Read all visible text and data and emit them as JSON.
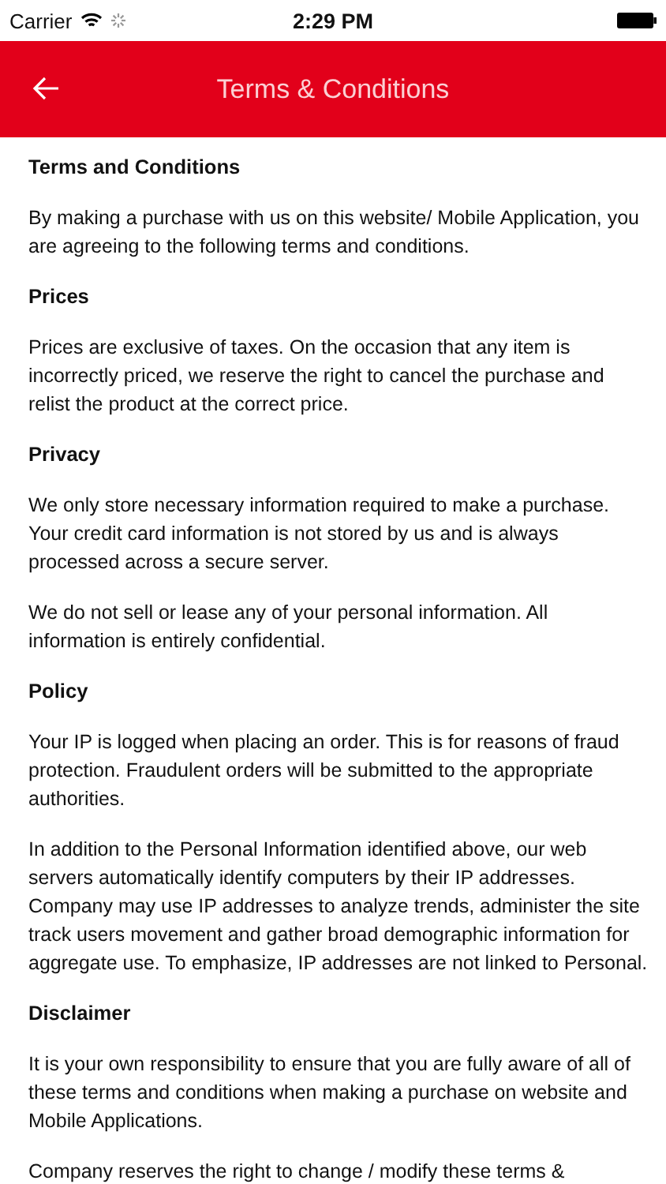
{
  "status_bar": {
    "carrier": "Carrier",
    "time": "2:29 PM"
  },
  "nav_bar": {
    "title": "Terms & Conditions"
  },
  "blocks": [
    {
      "kind": "heading",
      "lines": [
        "Terms and Conditions"
      ]
    },
    {
      "kind": "paragraph",
      "lines": [
        "By making a purchase with us on this website/ Mobile Application, you",
        "are agreeing to the following terms and conditions."
      ]
    },
    {
      "kind": "heading",
      "lines": [
        "Prices"
      ]
    },
    {
      "kind": "paragraph",
      "lines": [
        "Prices are exclusive of taxes. On the occasion that any item is",
        "incorrectly priced, we reserve the right to cancel the purchase and",
        "relist the product at the correct price."
      ]
    },
    {
      "kind": "heading",
      "lines": [
        "Privacy"
      ]
    },
    {
      "kind": "paragraph",
      "lines": [
        "We only store necessary information required to make a purchase.",
        "Your credit card information is not stored by us and is always",
        "processed across a secure server."
      ]
    },
    {
      "kind": "paragraph",
      "lines": [
        "We do not sell or lease any of your personal information. All",
        "information is entirely confidential."
      ]
    },
    {
      "kind": "heading",
      "lines": [
        "Policy"
      ]
    },
    {
      "kind": "paragraph",
      "lines": [
        "Your IP is logged when placing an order. This is for reasons of fraud",
        "protection. Fraudulent orders will be submitted to the appropriate",
        "authorities."
      ]
    },
    {
      "kind": "paragraph",
      "lines": [
        "In addition to the Personal Information identified above, our web",
        "servers automatically identify computers by their IP addresses.",
        "Company may use IP addresses to analyze trends, administer the site",
        "track users movement and gather broad demographic information for",
        "aggregate use. To emphasize, IP addresses are not linked to Personal."
      ]
    },
    {
      "kind": "heading",
      "lines": [
        "Disclaimer"
      ]
    },
    {
      "kind": "paragraph",
      "lines": [
        "It is your own responsibility to ensure that you are fully aware of all of",
        "these terms and conditions when making a purchase on website and",
        "Mobile Applications."
      ]
    },
    {
      "kind": "paragraph",
      "lines": [
        "Company reserves the right to change / modify these terms &"
      ]
    }
  ]
}
